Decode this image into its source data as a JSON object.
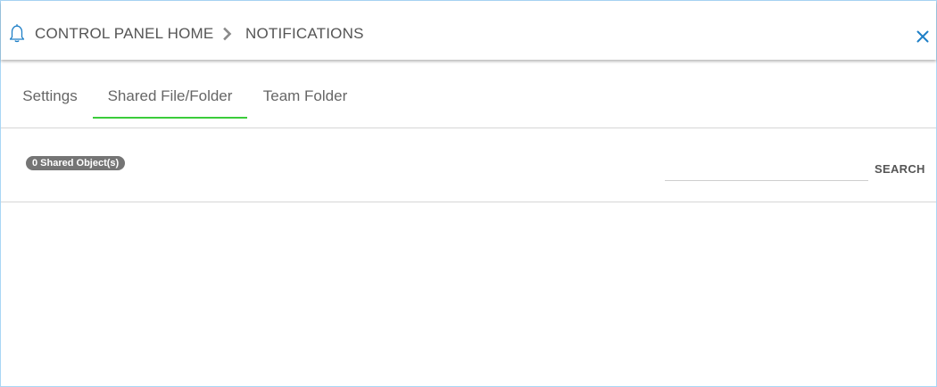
{
  "header": {
    "breadcrumb": {
      "home_label": "CONTROL PANEL HOME",
      "current_label": "NOTIFICATIONS"
    },
    "icons": {
      "bell": "bell-icon",
      "separator": "chevron-right-icon",
      "close": "close-icon"
    }
  },
  "tabs": [
    {
      "label": "Settings",
      "active": false
    },
    {
      "label": "Shared File/Folder",
      "active": true
    },
    {
      "label": "Team Folder",
      "active": false
    }
  ],
  "toolbar": {
    "count_badge": "0 Shared Object(s)",
    "search_value": "",
    "search_label": "SEARCH"
  },
  "colors": {
    "accent_icon": "#1e7fc7",
    "active_tab_underline": "#3bcc3b",
    "badge_background": "#757575",
    "dialog_border": "#a9d6f5"
  }
}
